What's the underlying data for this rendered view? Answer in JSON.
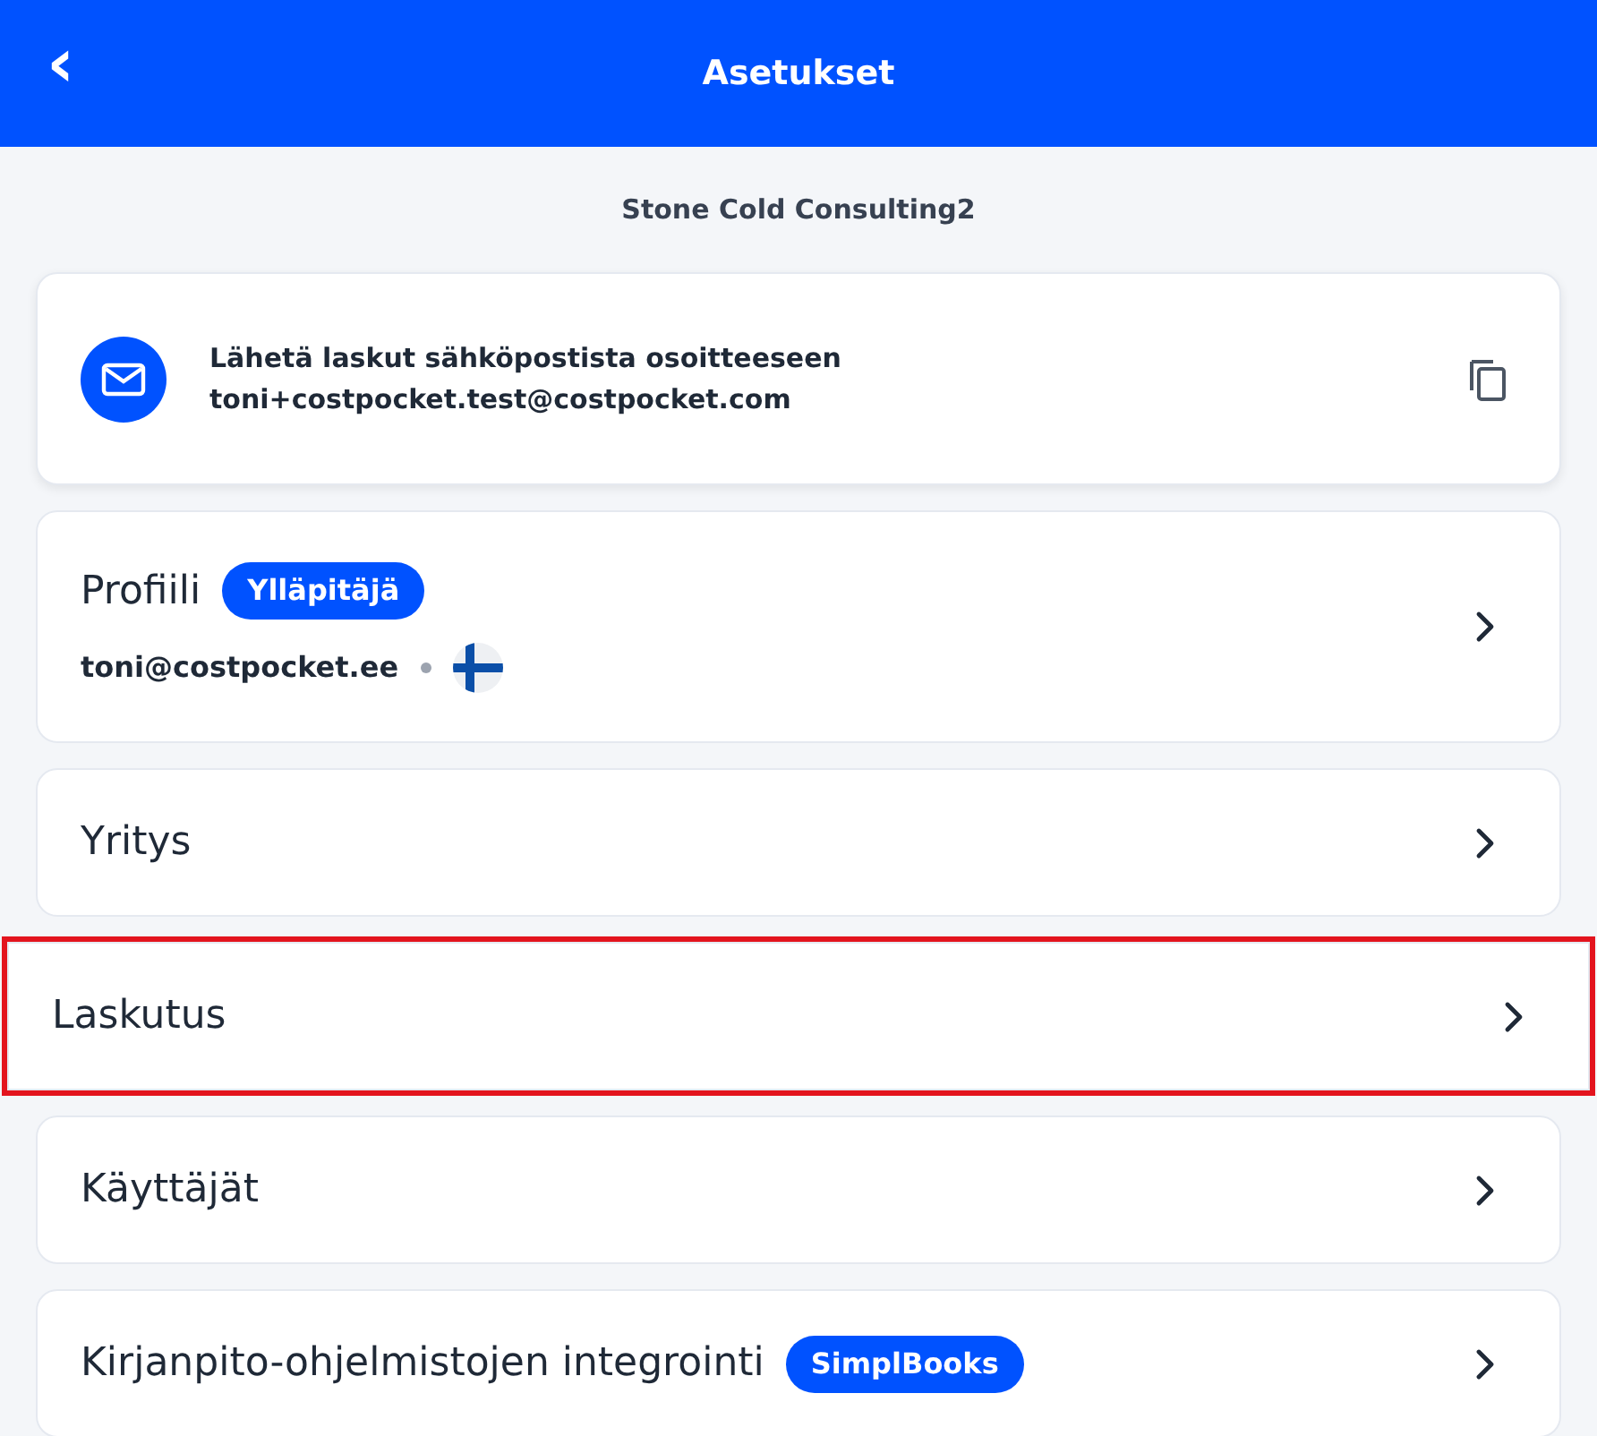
{
  "header": {
    "back": "‹",
    "title": "Asetukset"
  },
  "company": "Stone Cold Consulting2",
  "email_card": {
    "label": "Lähetä laskut sähköpostista osoitteeseen",
    "address": "toni+costpocket.test@costpocket.com"
  },
  "items": [
    {
      "kind": "profile",
      "title": "Profiili",
      "badge": "Ylläpitäjä",
      "email": "toni@costpocket.ee",
      "highlighted": false
    },
    {
      "kind": "plain",
      "title": "Yritys",
      "highlighted": false
    },
    {
      "kind": "plain",
      "title": "Laskutus",
      "highlighted": true
    },
    {
      "kind": "plain",
      "title": "Käyttäjät",
      "highlighted": false
    },
    {
      "kind": "plain",
      "title": "Kirjanpito-ohjelmistojen integrointi",
      "badge": "SimplBooks",
      "highlighted": false
    }
  ]
}
